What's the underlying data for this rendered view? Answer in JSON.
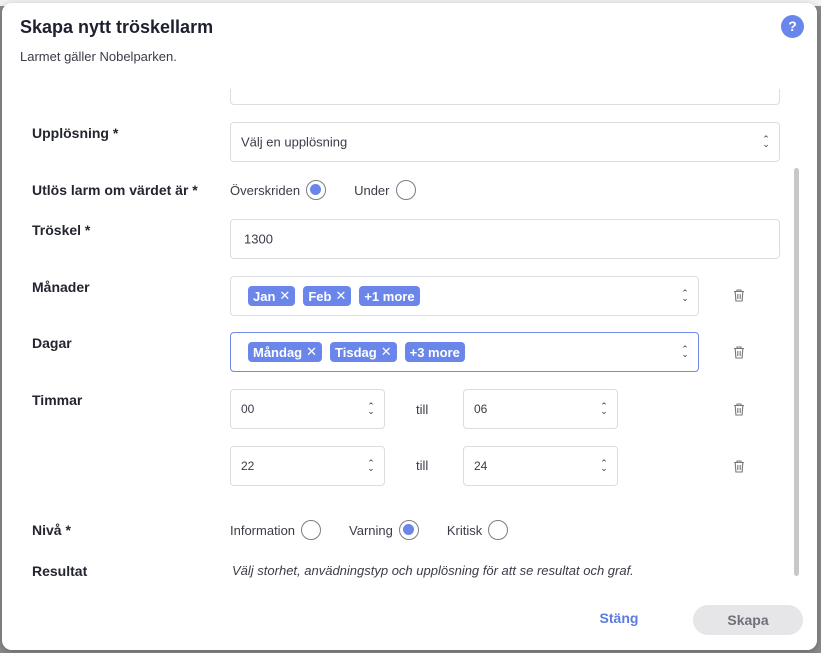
{
  "dialog": {
    "title": "Skapa nytt tröskellarm",
    "subtitle": "Larmet gäller Nobelparken.",
    "help_label": "?"
  },
  "form": {
    "resolution": {
      "label": "Upplösning *",
      "placeholder": "Välj en upplösning"
    },
    "trigger": {
      "label": "Utlös larm om värdet är *",
      "options": [
        {
          "label": "Överskriden",
          "checked": true
        },
        {
          "label": "Under",
          "checked": false
        }
      ]
    },
    "threshold": {
      "label": "Tröskel *",
      "value": "1300"
    },
    "months": {
      "label": "Månader",
      "chips": [
        "Jan",
        "Feb"
      ],
      "more": "+1 more"
    },
    "days": {
      "label": "Dagar",
      "chips": [
        "Måndag",
        "Tisdag"
      ],
      "more": "+3 more"
    },
    "hours": {
      "label": "Timmar",
      "separator": "till",
      "rows": [
        {
          "from": "00",
          "to": "06"
        },
        {
          "from": "22",
          "to": "24"
        }
      ]
    },
    "level": {
      "label": "Nivå *",
      "options": [
        {
          "label": "Information",
          "checked": false
        },
        {
          "label": "Varning",
          "checked": true
        },
        {
          "label": "Kritisk",
          "checked": false
        }
      ]
    },
    "result": {
      "label": "Resultat",
      "text": "Välj storhet, anvädningstyp och upplösning för att se resultat och graf."
    }
  },
  "footer": {
    "close_label": "Stäng",
    "create_label": "Skapa"
  },
  "colors": {
    "accent": "#6a86ea",
    "link": "#5b7be2",
    "disabled_button": "#e6e6e8"
  },
  "icons": {
    "remove_chip": "close-icon",
    "delete_row": "trash-icon",
    "select": "chevron-up-down-icon"
  }
}
